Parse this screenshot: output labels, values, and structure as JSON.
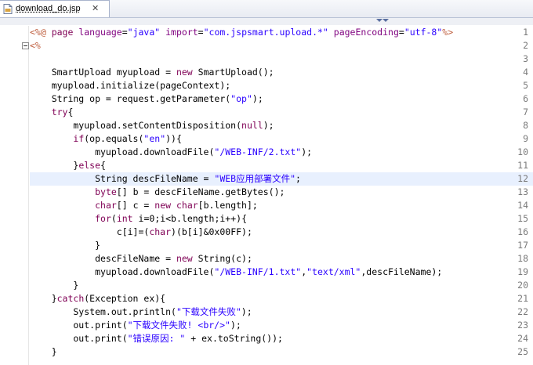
{
  "tab": {
    "label": "download_do.jsp",
    "close": "✕"
  },
  "gutter": {
    "line_numbers": [
      "1",
      "2",
      "3",
      "4",
      "5",
      "6",
      "7",
      "8",
      "9",
      "10",
      "11",
      "12",
      "13",
      "14",
      "15",
      "16",
      "17",
      "18",
      "19",
      "20",
      "21",
      "22",
      "23",
      "24",
      "25"
    ]
  },
  "code": {
    "line1": {
      "a": "<%@",
      "b": " page ",
      "c": "language",
      "d": "=",
      "e": "\"java\"",
      "f": " import",
      "g": "=",
      "h": "\"com.jspsmart.upload.*\"",
      "i": " pageEncoding",
      "j": "=",
      "k": "\"utf-8\"",
      "l": "%>"
    },
    "line2": "<%",
    "line3": "",
    "line4": "    SmartUpload myupload = ",
    "line4_kw": "new",
    "line4_end": " SmartUpload();",
    "line5": "    myupload.initialize(pageContext);",
    "line6a": "    String op = request.getParameter(",
    "line6s": "\"op\"",
    "line6b": ");",
    "line7kw": "try",
    "line7b": "{",
    "line8": "        myupload.setContentDisposition(",
    "line8kw": "null",
    "line8b": ");",
    "line9kw": "if",
    "line9a": "(op.equals(",
    "line9s": "\"en\"",
    "line9b": ")){",
    "line10a": "            myupload.downloadFile(",
    "line10s": "\"/WEB-INF/2.txt\"",
    "line10b": ");",
    "line11a": "        }",
    "line11kw": "else",
    "line11b": "{",
    "line12a": "            String descFileName = ",
    "line12s": "\"WEB应用部署文件\"",
    "line12b": ";",
    "line13kw": "byte",
    "line13b": "[] b = descFileName.getBytes();",
    "line14kw": "char",
    "line14b": "[] c = ",
    "line14kw2": "new",
    "line14kw3": " char",
    "line14c": "[b.length];",
    "line15kw": "for",
    "line15a": "(",
    "line15kw2": "int",
    "line15b": " i=0;i<b.length;i++){",
    "line16a": "                c[i]=(",
    "line16kw": "char",
    "line16b": ")(b[i]&0x00FF);",
    "line17": "            }",
    "line18a": "            descFileName = ",
    "line18kw": "new",
    "line18b": " String(c);",
    "line19a": "            myupload.downloadFile(",
    "line19s1": "\"/WEB-INF/1.txt\"",
    "line19c": ",",
    "line19s2": "\"text/xml\"",
    "line19b": ",descFileName);",
    "line20": "        }",
    "line21a": "    }",
    "line21kw": "catch",
    "line21b": "(Exception ex){",
    "line22a": "        System.out.println(",
    "line22s": "\"下载文件失败\"",
    "line22b": ");",
    "line23a": "        out.print(",
    "line23s": "\"下载文件失败! <br/>\"",
    "line23b": ");",
    "line24a": "        out.print(",
    "line24s": "\"错误原因: \"",
    "line24b": " + ex.toString());",
    "line25": "    }",
    "line26": "%>"
  },
  "colors": {
    "tag": "#bf5f3f",
    "keyword": "#7f0055",
    "attribute": "#7f007f",
    "string": "#2a00ff",
    "current_line": "#e8f0fe"
  },
  "icons": {
    "file": "jsp-file-icon",
    "fold": "fold-minus-icon",
    "collapse": "collapse-arrows-icon"
  }
}
